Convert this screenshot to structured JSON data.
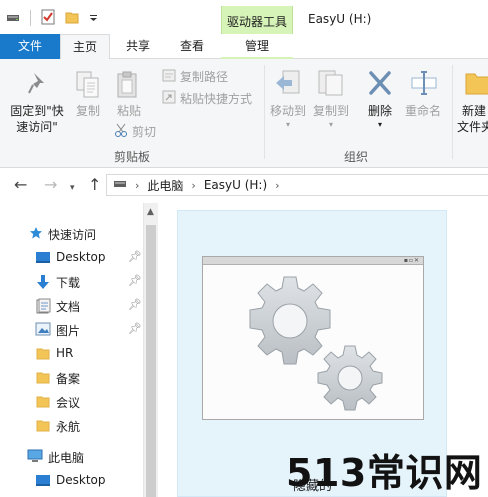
{
  "window": {
    "title": "EasyU (H:)",
    "tool_tab": "驱动器工具"
  },
  "tabs": {
    "file": "文件",
    "home": "主页",
    "share": "共享",
    "view": "查看",
    "manage": "管理"
  },
  "ribbon": {
    "pin_quick_access": "固定到\"快",
    "pin_quick_access_2": "速访问\"",
    "copy": "复制",
    "paste": "粘贴",
    "copy_path": "复制路径",
    "paste_shortcut": "粘贴快捷方式",
    "cut": "剪切",
    "clipboard_group": "剪贴板",
    "move_to": "移动到",
    "copy_to": "复制到",
    "delete": "删除",
    "rename": "重命名",
    "organize_group": "组织",
    "new_folder": "新建",
    "new_folder_2": "文件夹"
  },
  "address": {
    "root": "此电脑",
    "drive": "EasyU (H:)"
  },
  "navpane": {
    "quick_access": "快速访问",
    "items": [
      {
        "label": "Desktop",
        "icon": "desktop-icon",
        "pinned": true
      },
      {
        "label": "下载",
        "icon": "download-icon",
        "pinned": true
      },
      {
        "label": "文档",
        "icon": "document-icon",
        "pinned": true
      },
      {
        "label": "图片",
        "icon": "picture-icon",
        "pinned": true
      },
      {
        "label": "HR",
        "icon": "folder-icon",
        "pinned": false
      },
      {
        "label": "备案",
        "icon": "folder-icon",
        "pinned": false
      },
      {
        "label": "会议",
        "icon": "folder-icon",
        "pinned": false
      },
      {
        "label": "永航",
        "icon": "folder-icon",
        "pinned": false
      }
    ],
    "this_pc": "此电脑",
    "this_pc_desktop": "Desktop"
  },
  "content": {
    "tile_label": "隐藏的"
  },
  "watermark": "513常识网",
  "colors": {
    "file_tab": "#1979ca",
    "tool_tab": "#d6f3b8",
    "tile_bg": "#e5f3fb",
    "ribbon_bg": "#f5f6f7"
  }
}
